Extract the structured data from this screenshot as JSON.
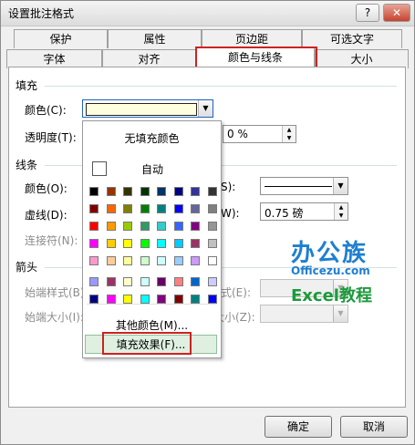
{
  "window": {
    "title": "设置批注格式",
    "help_label": "?",
    "close_label": "✕"
  },
  "tabs": {
    "row1": [
      "保护",
      "属性",
      "页边距",
      "可选文字"
    ],
    "row2": [
      "字体",
      "对齐",
      "颜色与线条",
      "大小"
    ],
    "active": "颜色与线条"
  },
  "fill": {
    "section_label": "填充",
    "color_label": "颜色(C):",
    "color_value_hex": "#ffffe0",
    "transparency_label": "透明度(T):",
    "transparency_value": "0 %"
  },
  "line": {
    "section_label": "线条",
    "color_label": "颜色(O):",
    "dash_label": "虚线(D):",
    "connector_label": "连接符(N):",
    "style_label_fragment": "S):",
    "weight_label_fragment": "W):",
    "weight_value": "0.75 磅"
  },
  "arrows": {
    "section_label": "箭头",
    "start_style_label": "始端样式(B)",
    "start_size_label": "始端大小(I):",
    "end_style_label_fragment": "式(E):",
    "end_size_label_fragment": "大小(Z):"
  },
  "color_popup": {
    "no_fill_label": "无填充颜色",
    "auto_label": "自动",
    "more_colors_label": "其他颜色(M)...",
    "fill_effects_label": "填充效果(F)...",
    "palette_main": [
      [
        "#000000",
        "#993300",
        "#333300",
        "#003300",
        "#003366",
        "#000080",
        "#333399",
        "#333333"
      ],
      [
        "#800000",
        "#FF6600",
        "#808000",
        "#008000",
        "#008080",
        "#0000FF",
        "#666699",
        "#808080"
      ],
      [
        "#FF0000",
        "#FF9900",
        "#99CC00",
        "#339966",
        "#33CCCC",
        "#3366FF",
        "#800080",
        "#969696"
      ],
      [
        "#FF00FF",
        "#FFCC00",
        "#FFFF00",
        "#00FF00",
        "#00FFFF",
        "#00CCFF",
        "#993366",
        "#C0C0C0"
      ],
      [
        "#FF99CC",
        "#FFCC99",
        "#FFFF99",
        "#CCFFCC",
        "#CCFFFF",
        "#99CCFF",
        "#CC99FF",
        "#FFFFFF"
      ]
    ],
    "palette_extra": [
      [
        "#9999FF",
        "#993366",
        "#FFFFCC",
        "#CCFFFF",
        "#660066",
        "#FF8080",
        "#0066CC",
        "#CCCCFF"
      ],
      [
        "#000080",
        "#FF00FF",
        "#FFFF00",
        "#00FFFF",
        "#800080",
        "#800000",
        "#008080",
        "#0000FF"
      ]
    ]
  },
  "watermark": {
    "brand": "办公族",
    "site": "Officezu.com",
    "tagline": "Excel教程"
  },
  "buttons": {
    "ok_label": "确定",
    "cancel_label": "取消"
  },
  "colors": {
    "highlight_red": "#d02020",
    "fill_effect_bg": "#dff0e1"
  }
}
